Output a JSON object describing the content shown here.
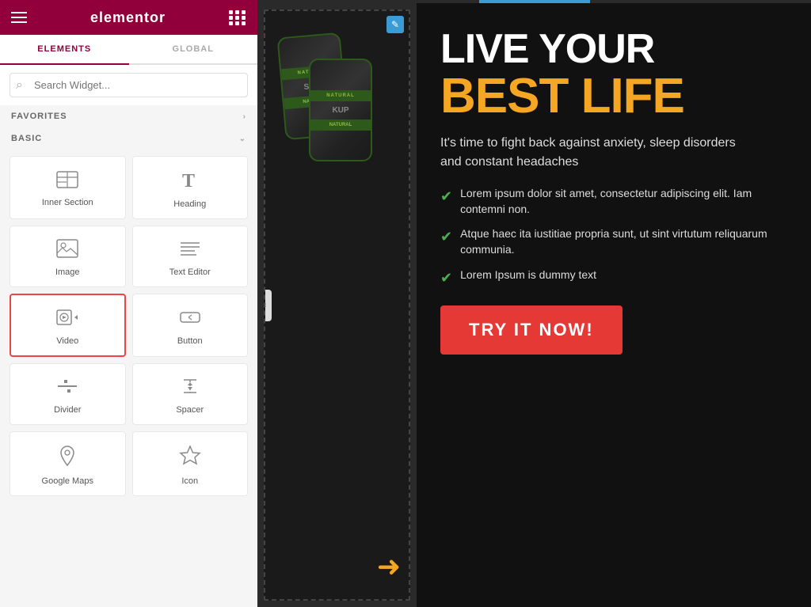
{
  "sidebar": {
    "header": {
      "logo": "elementor",
      "hamburger_label": "menu",
      "grid_label": "apps"
    },
    "tabs": [
      {
        "label": "ELEMENTS",
        "active": true
      },
      {
        "label": "GLOBAL",
        "active": false
      }
    ],
    "search": {
      "placeholder": "Search Widget..."
    },
    "sections": {
      "favorites": {
        "label": "FAVORITES",
        "arrow": "›"
      },
      "basic": {
        "label": "BASIC",
        "arrow": "⌄"
      }
    },
    "widgets": [
      {
        "id": "inner-section",
        "label": "Inner Section",
        "icon": "inner-section-icon",
        "selected": false
      },
      {
        "id": "heading",
        "label": "Heading",
        "icon": "heading-icon",
        "selected": false
      },
      {
        "id": "image",
        "label": "Image",
        "icon": "image-icon",
        "selected": false
      },
      {
        "id": "text-editor",
        "label": "Text Editor",
        "icon": "text-editor-icon",
        "selected": false
      },
      {
        "id": "video",
        "label": "Video",
        "icon": "video-icon",
        "selected": true
      },
      {
        "id": "button",
        "label": "Button",
        "icon": "button-icon",
        "selected": false
      },
      {
        "id": "divider",
        "label": "Divider",
        "icon": "divider-icon",
        "selected": false
      },
      {
        "id": "spacer",
        "label": "Spacer",
        "icon": "spacer-icon",
        "selected": false
      },
      {
        "id": "google-maps",
        "label": "Google Maps",
        "icon": "google-maps-icon",
        "selected": false
      },
      {
        "id": "icon",
        "label": "Icon",
        "icon": "icon-widget-icon",
        "selected": false
      }
    ]
  },
  "canvas": {
    "edit_icon": "✎",
    "chevron_left": "‹",
    "can_label_1": "NATURAL",
    "can_label_2": "NATURAL",
    "can_text_1": "STIC",
    "can_text_2": "KUP",
    "arrow": "➜"
  },
  "hero": {
    "headline_line1": "LIVE YOUR",
    "headline_line2": "BEST LIFE",
    "subtext": "It's time to fight back against anxiety, sleep disorders and constant headaches",
    "checklist": [
      "Lorem ipsum dolor sit amet, consectetur adipiscing elit. Iam contemni non.",
      "Atque haec ita iustitiae propria sunt, ut sint virtutum reliquarum communia.",
      "Lorem Ipsum is dummy text"
    ],
    "cta_label": "TRY IT NOW!"
  }
}
